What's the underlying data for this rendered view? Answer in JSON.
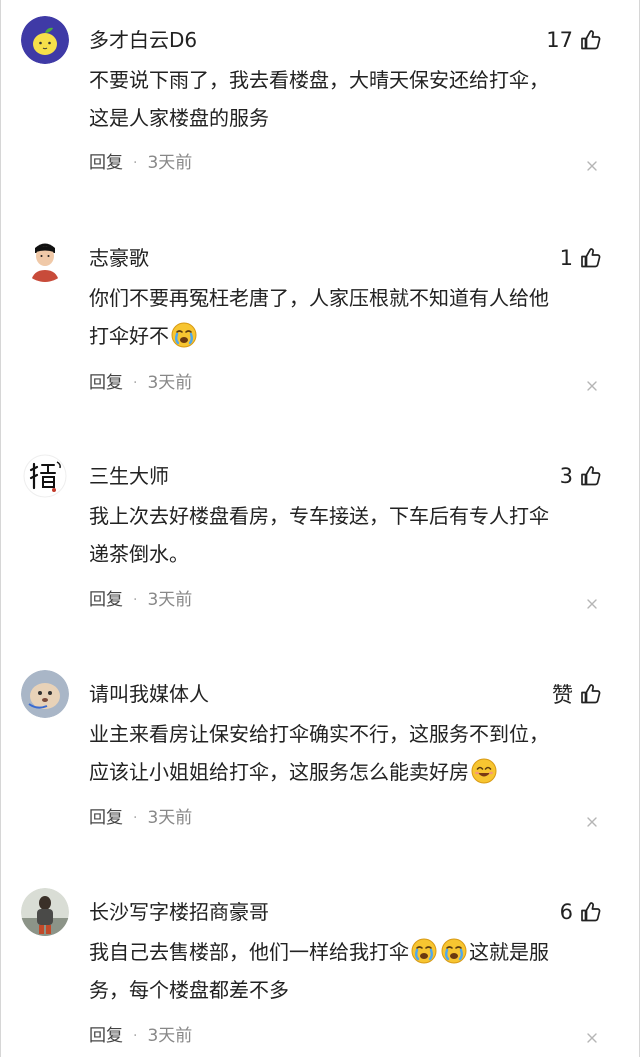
{
  "comments": [
    {
      "username": "多才白云D6",
      "likes": "17",
      "content": "不要说下雨了，我去看楼盘，大晴天保安还给打伞，\n这是人家楼盘的服务",
      "reply_label": "回复",
      "separator": "·",
      "time": "3天前",
      "avatar_icon": "lemon-avatar-icon",
      "avatar_bg": "#3f3aa6"
    },
    {
      "username": "志豪歌",
      "likes": "1",
      "content_parts": [
        "你们不要再冤枉老唐了，人家压根就不知道有人给他\n打伞好不"
      ],
      "content_emoji": "crying-face-emoji",
      "reply_label": "回复",
      "separator": "·",
      "time": "3天前",
      "avatar_icon": "person-avatar-icon"
    },
    {
      "username": "三生大师",
      "likes": "3",
      "content": "我上次去好楼盘看房，专车接送，下车后有专人打伞\n递茶倒水。",
      "reply_label": "回复",
      "separator": "·",
      "time": "3天前",
      "avatar_icon": "calligraphy-avatar-icon"
    },
    {
      "username": "请叫我媒体人",
      "likes": "赞",
      "content": "业主来看房让保安给打伞确实不行，这服务不到位，\n应该让小姐姐给打伞，这服务怎么能卖好房",
      "content_emoji": "smiling-face-emoji",
      "reply_label": "回复",
      "separator": "·",
      "time": "3天前",
      "avatar_icon": "pet-avatar-icon"
    },
    {
      "username": "长沙写字楼招商豪哥",
      "likes": "6",
      "content_a": "我自己去售楼部，他们一样给我打伞",
      "content_b": "这就是服\n务，每个楼盘都差不多",
      "content_emoji": "loudly-crying-face-emoji",
      "reply_label": "回复",
      "separator": "·",
      "time": "3天前",
      "avatar_icon": "photo-avatar-icon"
    }
  ]
}
